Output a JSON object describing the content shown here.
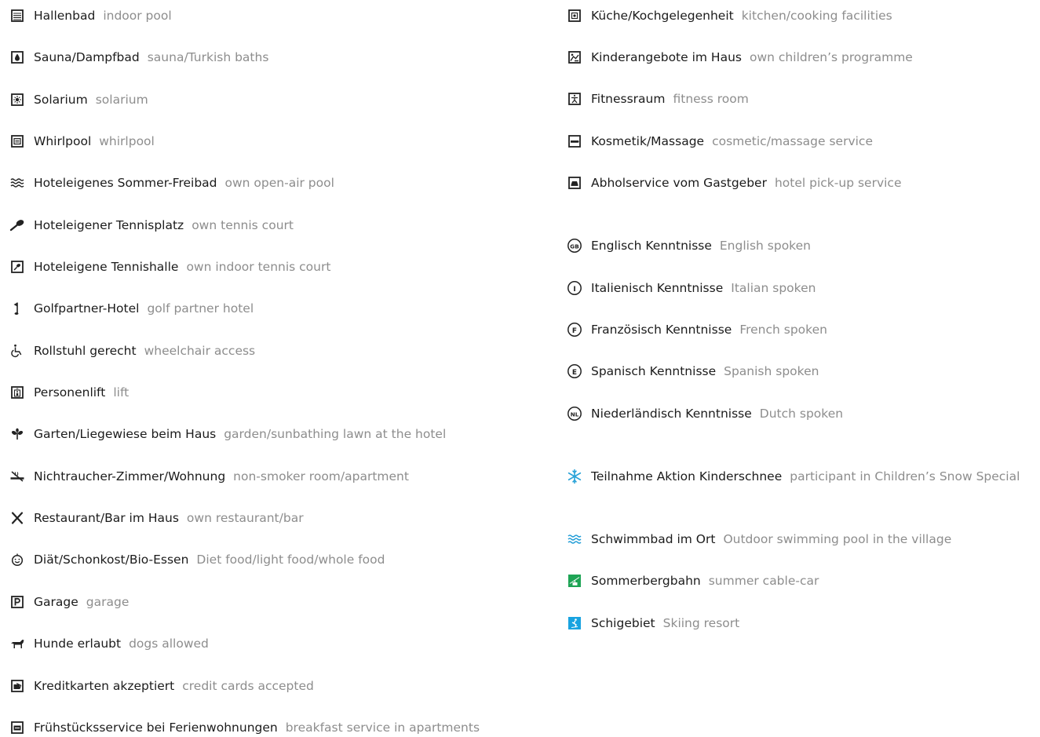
{
  "left": [
    {
      "icon": "indoor-pool-icon",
      "de": "Hallenbad",
      "en": "indoor pool"
    },
    {
      "icon": "sauna-icon",
      "de": "Sauna/Dampfbad",
      "en": "sauna/Turkish baths"
    },
    {
      "icon": "solarium-icon",
      "de": "Solarium",
      "en": "solarium"
    },
    {
      "icon": "whirlpool-icon",
      "de": "Whirlpool",
      "en": "whirlpool"
    },
    {
      "icon": "open-air-pool-icon",
      "de": "Hoteleigenes Sommer-Freibad",
      "en": "own open-air pool"
    },
    {
      "icon": "tennis-court-icon",
      "de": "Hoteleigener Tennisplatz",
      "en": "own tennis court"
    },
    {
      "icon": "indoor-tennis-icon",
      "de": "Hoteleigene Tennishalle",
      "en": "own indoor tennis court"
    },
    {
      "icon": "golf-flag-icon",
      "de": "Golfpartner-Hotel",
      "en": "golf partner hotel"
    },
    {
      "icon": "wheelchair-icon",
      "de": "Rollstuhl gerecht",
      "en": "wheelchair access"
    },
    {
      "icon": "lift-icon",
      "de": "Personenlift",
      "en": "lift"
    },
    {
      "icon": "garden-icon",
      "de": "Garten/Liegewiese beim Haus",
      "en": "garden/sunbathing lawn at the hotel"
    },
    {
      "icon": "no-smoking-icon",
      "de": "Nichtraucher-Zimmer/Wohnung",
      "en": "non-smoker room/apartment"
    },
    {
      "icon": "restaurant-icon",
      "de": "Restaurant/Bar im Haus",
      "en": "own restaurant/bar"
    },
    {
      "icon": "diet-food-icon",
      "de": "Diät/Schonkost/Bio-Essen",
      "en": "Diet food/light food/whole food"
    },
    {
      "icon": "parking-icon",
      "de": "Garage",
      "en": "garage"
    },
    {
      "icon": "dog-icon",
      "de": "Hunde erlaubt",
      "en": "dogs allowed"
    },
    {
      "icon": "credit-card-icon",
      "de": "Kreditkarten akzeptiert",
      "en": "credit cards accepted"
    },
    {
      "icon": "breakfast-icon",
      "de": "Frühstücksservice bei Ferienwohnungen",
      "en": "breakfast service in apartments"
    }
  ],
  "right": [
    {
      "icon": "kitchen-icon",
      "de": "Küche/Kochgelegenheit",
      "en": "kitchen/cooking facilities"
    },
    {
      "icon": "children-programme-icon",
      "de": "Kinderangebote im Haus",
      "en": "own children’s programme"
    },
    {
      "icon": "fitness-icon",
      "de": "Fitnessraum",
      "en": "fitness room"
    },
    {
      "icon": "massage-icon",
      "de": "Kosmetik/Massage",
      "en": "cosmetic/massage service"
    },
    {
      "icon": "pickup-car-icon",
      "de": "Abholservice vom Gastgeber",
      "en": "hotel pick-up service"
    },
    {
      "icon": "english-badge-icon",
      "badge": "GB",
      "de": "Englisch Kenntnisse",
      "en": "English spoken"
    },
    {
      "icon": "italian-badge-icon",
      "badge": "I",
      "de": "Italienisch Kenntnisse",
      "en": "Italian spoken"
    },
    {
      "icon": "french-badge-icon",
      "badge": "F",
      "de": "Französisch Kenntnisse",
      "en": "French spoken"
    },
    {
      "icon": "spanish-badge-icon",
      "badge": "E",
      "de": "Spanisch Kenntnisse",
      "en": "Spanish spoken"
    },
    {
      "icon": "dutch-badge-icon",
      "badge": "NL",
      "de": "Niederländisch Kenntnisse",
      "en": "Dutch spoken"
    },
    {
      "icon": "snowflake-icon",
      "de": "Teilnahme Aktion Kinderschnee",
      "en": "participant in Children’s Snow Special"
    },
    {
      "icon": "village-pool-icon",
      "de": "Schwimmbad im Ort",
      "en": "Outdoor swimming pool in the village"
    },
    {
      "icon": "cable-car-icon",
      "de": "Sommerbergbahn",
      "en": "summer cable-car"
    },
    {
      "icon": "skier-icon",
      "de": "Schigebiet",
      "en": "Skiing resort"
    }
  ],
  "colors": {
    "text_de": "#1b1b1b",
    "text_en": "#8d8d8d",
    "snow_blue": "#2aa3d8",
    "pool_blue": "#1a9ad6",
    "cable_green": "#1ea455",
    "ski_blue": "#19a3e0"
  }
}
